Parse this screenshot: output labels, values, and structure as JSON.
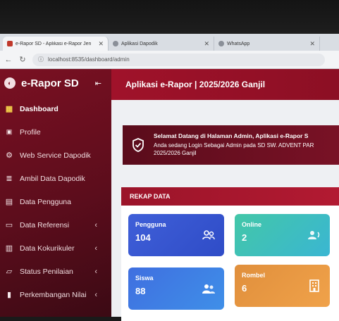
{
  "browser": {
    "tabs": [
      {
        "title": "e-Rapor SD - Aplikasi e-Rapor Jen"
      },
      {
        "title": "Aplikasi Dapodik"
      },
      {
        "title": "WhatsApp"
      }
    ],
    "url": "localhost:8535/dashboard/admin"
  },
  "sidebar": {
    "brand": "e-Rapor SD",
    "items": [
      {
        "label": "Dashboard",
        "icon": "dashboard-grid-icon",
        "active": true
      },
      {
        "label": "Profile",
        "icon": "id-card-icon"
      },
      {
        "label": "Web Service Dapodik",
        "icon": "gear-icon"
      },
      {
        "label": "Ambil Data Dapodik",
        "icon": "database-icon"
      },
      {
        "label": "Data Pengguna",
        "icon": "users-book-icon"
      },
      {
        "label": "Data Referensi",
        "icon": "monitor-icon",
        "has_submenu": true
      },
      {
        "label": "Data Kokurikuler",
        "icon": "calendar-icon",
        "has_submenu": true
      },
      {
        "label": "Status Penilaian",
        "icon": "folder-icon",
        "has_submenu": true
      },
      {
        "label": "Perkembangan Nilai",
        "icon": "chart-icon",
        "has_submenu": true
      }
    ]
  },
  "header": {
    "title": "Aplikasi e-Rapor | 2025/2026 Ganjil"
  },
  "welcome": {
    "title": "Selamat Datang di Halaman Admin, Aplikasi e-Rapor S",
    "line1": "Anda sedang Login Sebagai Admin pada SD SW. ADVENT PAR",
    "line2": "2025/2026 Ganjil"
  },
  "rekap": {
    "heading": "REKAP DATA",
    "cards": [
      {
        "label": "Pengguna",
        "value": "104",
        "icon": "users-icon",
        "color": "#3f5fd8"
      },
      {
        "label": "Online",
        "value": "2",
        "icon": "online-users-icon",
        "color": "#43c7a8"
      },
      {
        "label": "Siswa",
        "value": "88",
        "icon": "students-icon",
        "color": "#3f6fe0"
      },
      {
        "label": "Rombel",
        "value": "6",
        "icon": "building-icon",
        "color": "#e08f3c"
      }
    ]
  },
  "colors": {
    "sidebar": "#6a0f1f",
    "topbar": "#a0122a",
    "accent_active": "#f5d24b"
  }
}
